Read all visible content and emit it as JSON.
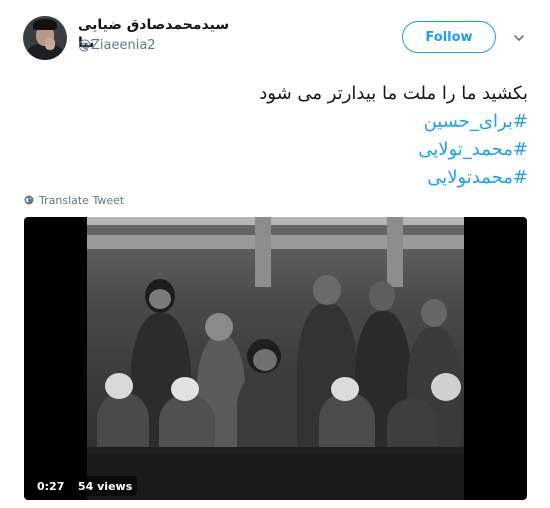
{
  "user": {
    "display_name": "سیدمحمدصادق ضیایی نیا",
    "handle": "@Ziaeenia2"
  },
  "header": {
    "follow_label": "Follow",
    "caret_icon": "chevron-down-icon"
  },
  "tweet": {
    "lines": [
      {
        "text": "بکشید ما را ملت ما بیدارتر می شود",
        "type": "text"
      },
      {
        "text": "#برای_حسین",
        "type": "hashtag"
      },
      {
        "text": "#محمد_تولایی",
        "type": "hashtag"
      },
      {
        "text": "#محمدتولایی",
        "type": "hashtag"
      }
    ],
    "translate_label": "Translate Tweet",
    "translate_icon": "globe-icon"
  },
  "media": {
    "duration": "0:27",
    "views": "54 views"
  },
  "colors": {
    "accent": "#1da1f2",
    "text": "#14171a",
    "muted": "#657786"
  }
}
